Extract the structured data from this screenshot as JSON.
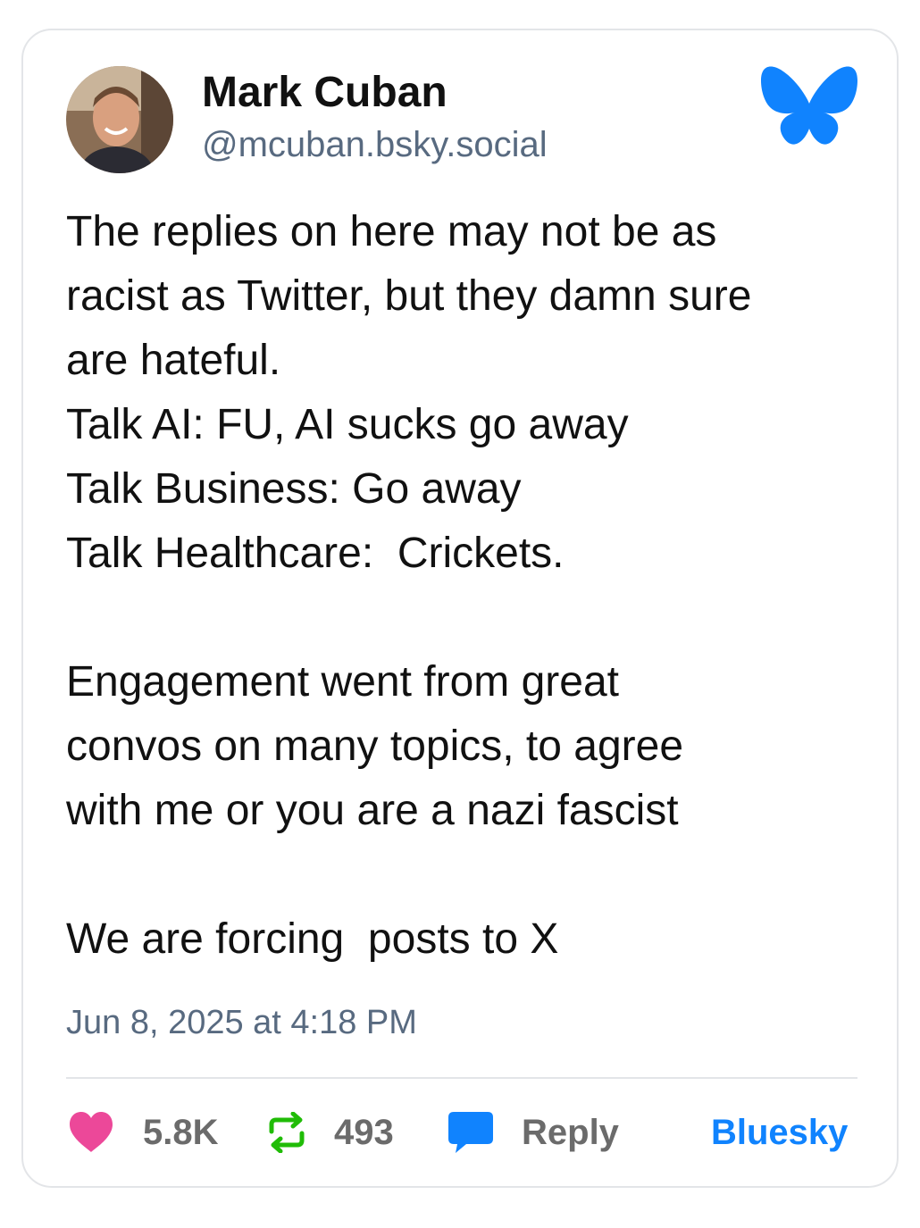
{
  "author": {
    "name": "Mark Cuban",
    "handle": "@mcuban.bsky.social",
    "avatar_icon": "avatar-photo"
  },
  "platform": {
    "logo_icon": "butterfly-icon",
    "link_label": "Bluesky",
    "brand_color": "#1083fe"
  },
  "post": {
    "text": "The replies on here may not be as\nracist as Twitter, but they damn sure\nare hateful.\nTalk AI: FU, AI sucks go away\nTalk Business: Go away\nTalk Healthcare:  Crickets.\n\nEngagement went from great\nconvos on many topics, to agree\nwith me or you are a nazi fascist\n\nWe are forcing  posts to X",
    "timestamp": "Jun 8, 2025 at 4:18 PM"
  },
  "actions": {
    "likes": {
      "icon": "heart-icon",
      "count": "5.8K",
      "color": "#ec4899"
    },
    "reposts": {
      "icon": "repost-icon",
      "count": "493",
      "color": "#20bc07"
    },
    "reply": {
      "icon": "reply-bubble-icon",
      "label": "Reply",
      "color": "#1083fe"
    }
  }
}
